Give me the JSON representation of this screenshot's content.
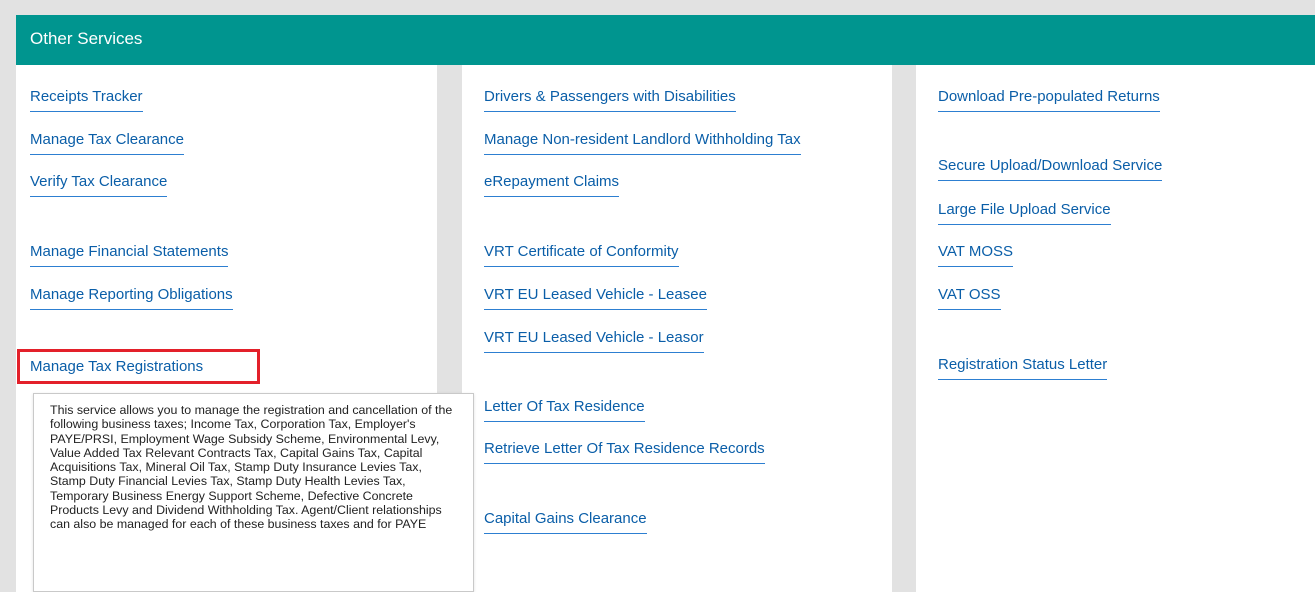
{
  "panel": {
    "title": "Other Services"
  },
  "columns": [
    {
      "links": [
        "Receipts Tracker",
        "Manage Tax Clearance",
        "Verify Tax Clearance",
        "Manage Financial Statements",
        "Manage Reporting Obligations",
        "Manage Tax Registrations"
      ]
    },
    {
      "links": [
        "Drivers & Passengers with Disabilities",
        "Manage Non-resident Landlord Withholding Tax",
        "eRepayment Claims",
        "VRT Certificate of Conformity",
        "VRT EU Leased Vehicle - Leasee",
        "VRT EU Leased Vehicle - Leasor",
        "Letter Of Tax Residence",
        "Retrieve Letter Of Tax Residence Records",
        "Capital Gains Clearance"
      ]
    },
    {
      "links": [
        "Download Pre-populated Returns",
        "Secure Upload/Download Service",
        "Large File Upload Service",
        "VAT MOSS",
        "VAT OSS",
        "Registration Status Letter"
      ]
    }
  ],
  "tooltip": {
    "text": "This service allows you to manage the registration and cancellation of the following business taxes; Income Tax, Corporation Tax, Employer's PAYE/PRSI, Employment Wage Subsidy Scheme, Environmental Levy, Value Added Tax Relevant Contracts Tax, Capital Gains Tax, Capital Acquisitions Tax, Mineral Oil Tax, Stamp Duty Insurance Levies Tax, Stamp Duty Financial Levies Tax, Stamp Duty Health Levies Tax, Temporary Business Energy Support Scheme, Defective Concrete Products Levy and Dividend Withholding Tax. Agent/Client relationships can also be managed for each of these business taxes and for PAYE"
  },
  "colors": {
    "header": "#00958f",
    "link": "#0a5ea8",
    "highlight": "#e3202a"
  }
}
